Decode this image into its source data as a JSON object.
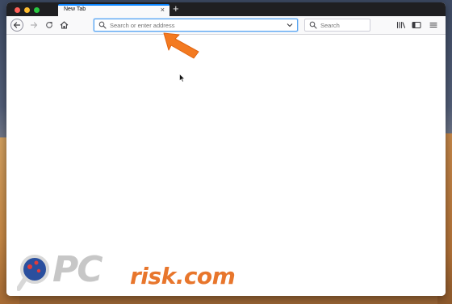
{
  "browser": {
    "tabs": [
      {
        "title": "New Tab",
        "active": true
      }
    ],
    "new_tab_symbol": "+",
    "tab_close_symbol": "×",
    "url_bar": {
      "placeholder": "Search or enter address",
      "value": ""
    },
    "search_bar": {
      "placeholder": "Search",
      "value": ""
    },
    "accent_color": "#0a84ff"
  },
  "watermark": {
    "brand_pc": "PC",
    "brand_risk": "risk.com",
    "brand_color": "#e8762c"
  },
  "annotation": {
    "arrow_color": "#f37a21",
    "arrow_target": "url-bar"
  },
  "icons": [
    "back-arrow-icon",
    "forward-arrow-icon",
    "reload-icon",
    "home-icon",
    "search-icon",
    "dropdown-icon",
    "library-icon",
    "sidebar-icon",
    "hamburger-menu-icon",
    "mouse-cursor-icon"
  ]
}
